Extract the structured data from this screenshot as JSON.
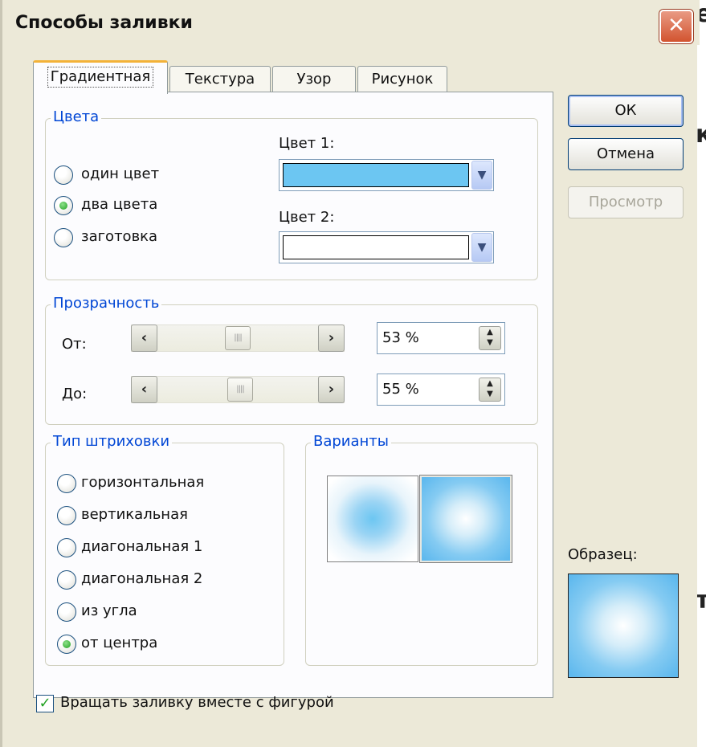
{
  "window": {
    "title": "Способы заливки",
    "close_symbol": "✕"
  },
  "background": {
    "fragments": [
      "е",
      "к",
      "т"
    ]
  },
  "tabs": [
    {
      "label": "Градиентная",
      "active": true
    },
    {
      "label": "Текстура",
      "active": false
    },
    {
      "label": "Узор",
      "active": false
    },
    {
      "label": "Рисунок",
      "active": false
    }
  ],
  "colors_group": {
    "legend": "Цвета",
    "options": [
      {
        "label": "один цвет",
        "checked": false
      },
      {
        "label": "два цвета",
        "checked": true
      },
      {
        "label": "заготовка",
        "checked": false
      }
    ],
    "color1_label": "Цвет 1:",
    "color1_value": "#6cc6f2",
    "color2_label": "Цвет 2:",
    "color2_value": "#ffffff"
  },
  "transparency_group": {
    "legend": "Прозрачность",
    "from_label": "От:",
    "from_value": "53 %",
    "from_fraction": 0.53,
    "to_label": "До:",
    "to_value": "55 %",
    "to_fraction": 0.55
  },
  "hatch_group": {
    "legend": "Тип штриховки",
    "options": [
      {
        "label": "горизонтальная",
        "checked": false
      },
      {
        "label": "вертикальная",
        "checked": false
      },
      {
        "label": "диагональная 1",
        "checked": false
      },
      {
        "label": "диагональная 2",
        "checked": false
      },
      {
        "label": "из угла",
        "checked": false
      },
      {
        "label": "от центра",
        "checked": true
      }
    ]
  },
  "variants_group": {
    "legend": "Варианты",
    "selected_index": 1
  },
  "buttons": {
    "ok": "ОК",
    "cancel": "Отмена",
    "preview": "Просмотр"
  },
  "sample": {
    "label": "Образец:"
  },
  "rotate_checkbox": {
    "label": "Вращать заливку вместе с фигурой",
    "checked": true
  },
  "icons": [
    "close-icon",
    "dropdown-arrow-icon",
    "scroll-left-icon",
    "scroll-right-icon",
    "spin-updown-icon",
    "checkmark-icon"
  ]
}
